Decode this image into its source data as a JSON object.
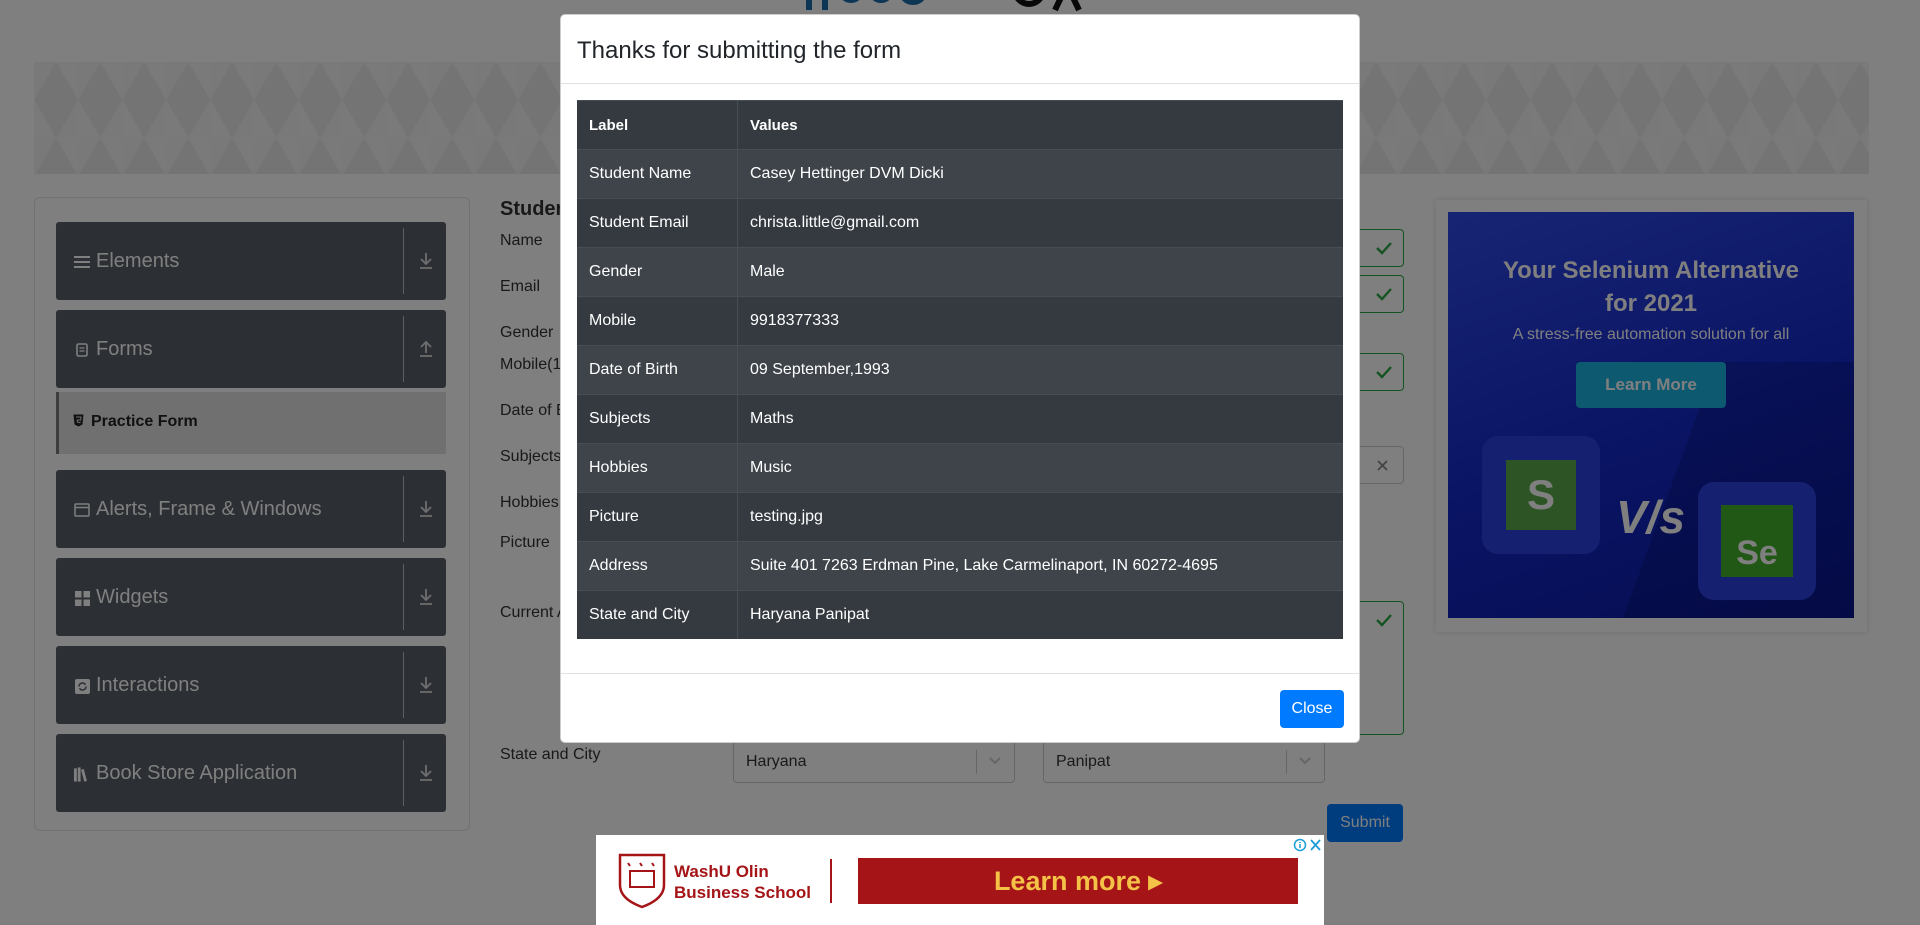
{
  "sidebar": {
    "groups": [
      {
        "label": "Elements",
        "icon": "menu-lines-icon",
        "toggle": "download-icon"
      },
      {
        "label": "Forms",
        "icon": "document-icon",
        "toggle": "upload-icon"
      },
      {
        "label": "Alerts, Frame & Windows",
        "icon": "window-icon",
        "toggle": "download-icon"
      },
      {
        "label": "Widgets",
        "icon": "grid-blocks-icon",
        "toggle": "download-icon"
      },
      {
        "label": "Interactions",
        "icon": "refresh-icon",
        "toggle": "download-icon"
      },
      {
        "label": "Book Store Application",
        "icon": "books-icon",
        "toggle": "download-icon"
      }
    ],
    "active_item": {
      "label": "Practice Form",
      "icon": "html-icon"
    }
  },
  "form": {
    "title": "Studen",
    "labels": {
      "name": "Name",
      "email": "Email",
      "gender": "Gender",
      "mobile": "Mobile(1",
      "dob": "Date of B",
      "subjects": "Subjects",
      "hobbies": "Hobbies",
      "picture": "Picture",
      "address": "Current A",
      "state_city": "State and City"
    },
    "state_value": "Haryana",
    "city_value": "Panipat",
    "submit_label": "Submit"
  },
  "ad_right": {
    "title": "Your Selenium Alternative for 2021",
    "subtitle": "A stress-free automation solution for all",
    "cta": "Learn More",
    "vs_text": "V/s",
    "left_logo": "S",
    "right_logo": "Se"
  },
  "ad_bottom": {
    "brand_line1": "WashU Olin",
    "brand_line2": "Business School",
    "cta": "Learn more ▸"
  },
  "modal": {
    "title": "Thanks for submitting the form",
    "headers": [
      "Label",
      "Values"
    ],
    "rows": [
      [
        "Student Name",
        "Casey Hettinger DVM Dicki"
      ],
      [
        "Student Email",
        "christa.little@gmail.com"
      ],
      [
        "Gender",
        "Male"
      ],
      [
        "Mobile",
        "9918377333"
      ],
      [
        "Date of Birth",
        "09 September,1993"
      ],
      [
        "Subjects",
        "Maths"
      ],
      [
        "Hobbies",
        "Music"
      ],
      [
        "Picture",
        "testing.jpg"
      ],
      [
        "Address",
        "Suite 401 7263 Erdman Pine, Lake Carmelinaport, IN 60272-4695"
      ],
      [
        "State and City",
        "Haryana Panipat"
      ]
    ],
    "close_label": "Close"
  },
  "colors": {
    "primary": "#007bff",
    "sidebar_bg": "#595f66",
    "table_dark": "#343a40",
    "valid_green": "#28a745",
    "ad_red": "#a51417"
  }
}
